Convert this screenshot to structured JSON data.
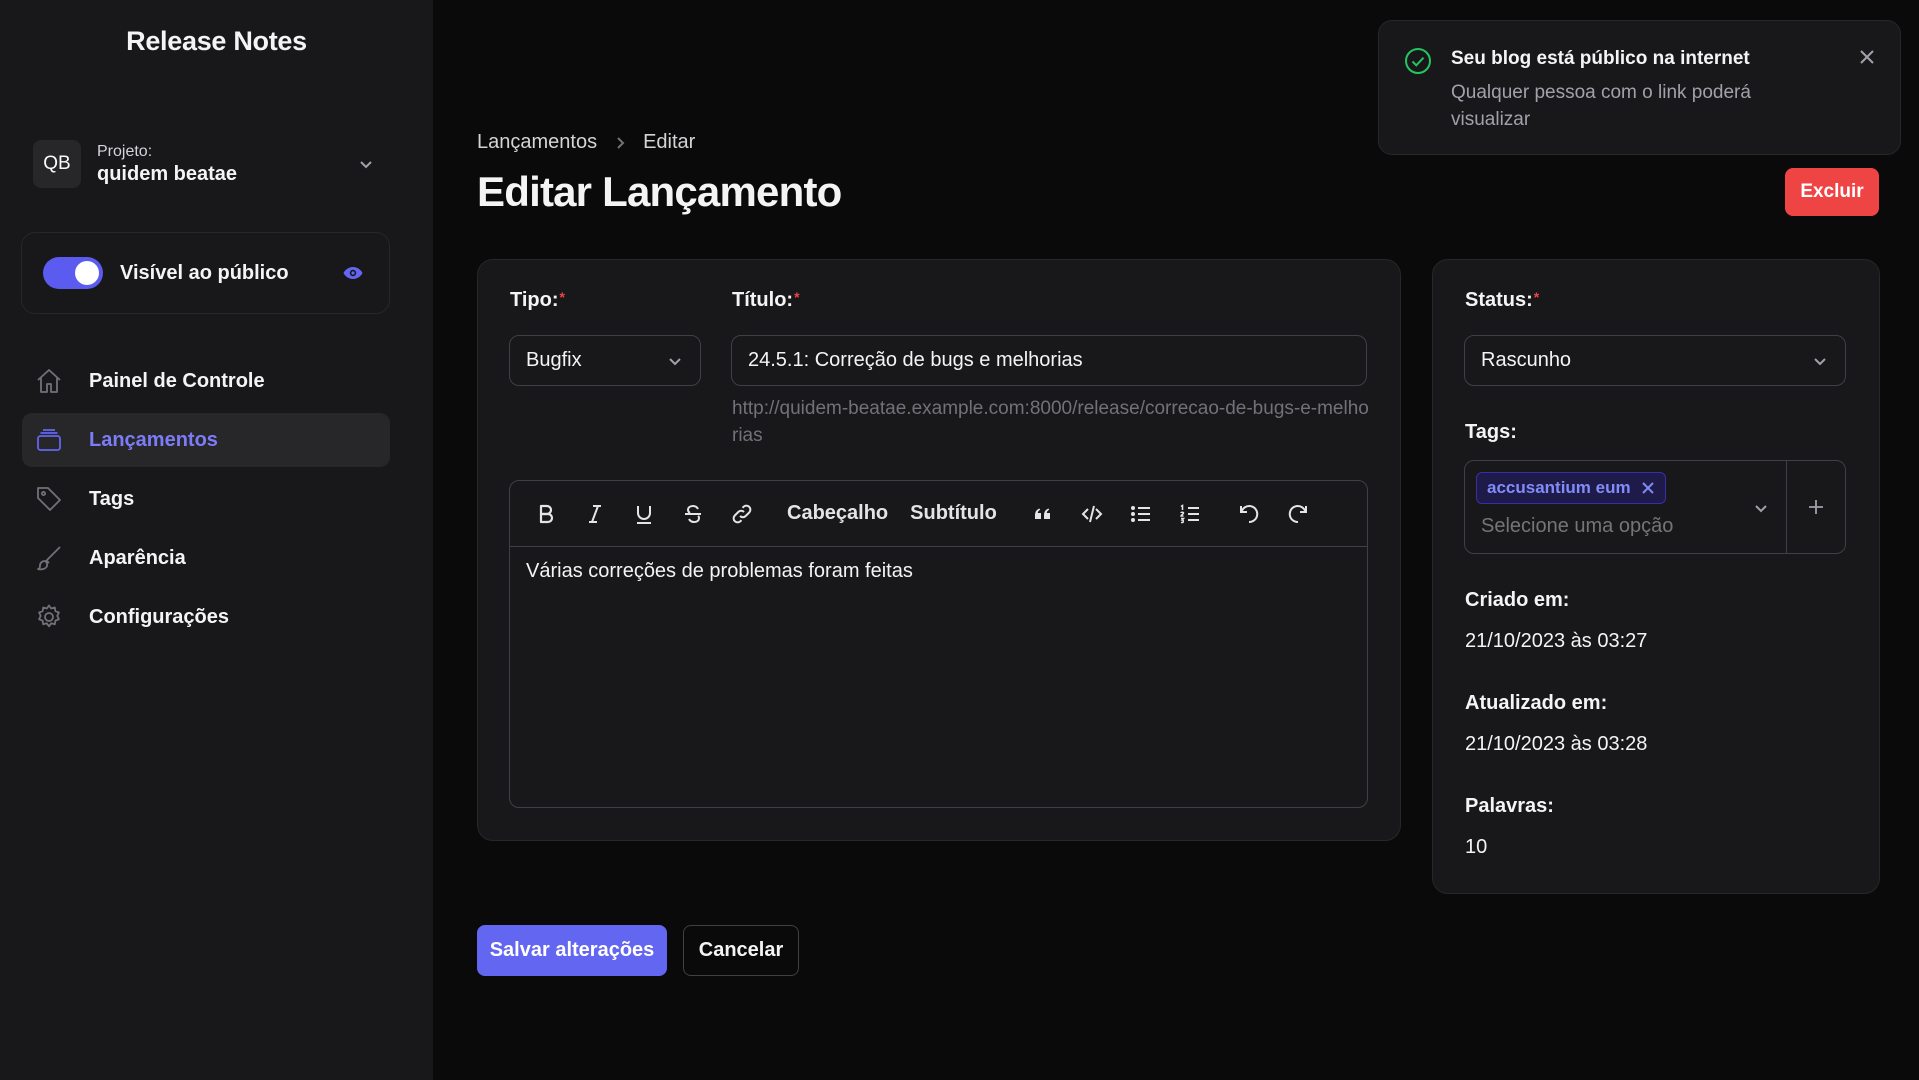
{
  "sidebar": {
    "app_title": "Release Notes",
    "project": {
      "avatar_initials": "QB",
      "label": "Projeto:",
      "name": "quidem beatae"
    },
    "visibility": {
      "label": "Visível ao público",
      "enabled": true
    },
    "nav": [
      {
        "label": "Painel de Controle",
        "icon": "home-icon",
        "active": false
      },
      {
        "label": "Lançamentos",
        "icon": "layers-icon",
        "active": true
      },
      {
        "label": "Tags",
        "icon": "tag-icon",
        "active": false
      },
      {
        "label": "Aparência",
        "icon": "brush-icon",
        "active": false
      },
      {
        "label": "Configurações",
        "icon": "gear-icon",
        "active": false
      }
    ]
  },
  "header": {
    "breadcrumb": [
      "Lançamentos",
      "Editar"
    ],
    "title": "Editar Lançamento",
    "delete_label": "Excluir"
  },
  "form": {
    "type": {
      "label": "Tipo:",
      "value": "Bugfix"
    },
    "title": {
      "label": "Título:",
      "value": "24.5.1: Correção de bugs e melhorias"
    },
    "slug_url": "http://quidem-beatae.example.com:8000/release/correcao-de-bugs-e-melhorias",
    "editor": {
      "heading_label": "Cabeçalho",
      "subtitle_label": "Subtítulo",
      "content": "Várias correções de problemas foram feitas"
    },
    "required_mark": "*"
  },
  "side": {
    "status": {
      "label": "Status:",
      "value": "Rascunho"
    },
    "tags": {
      "label": "Tags:",
      "selected": [
        "accusantium eum"
      ],
      "placeholder": "Selecione uma opção"
    },
    "created": {
      "label": "Criado em:",
      "value": "21/10/2023 às 03:27"
    },
    "updated": {
      "label": "Atualizado em:",
      "value": "21/10/2023 às 03:28"
    },
    "words": {
      "label": "Palavras:",
      "value": "10"
    }
  },
  "actions": {
    "save_label": "Salvar alterações",
    "cancel_label": "Cancelar"
  },
  "toast": {
    "title": "Seu blog está público na internet",
    "message": "Qualquer pessoa com o link poderá visualizar"
  },
  "colors": {
    "accent": "#6366f1",
    "danger": "#ef4444",
    "success": "#22c55e",
    "background": "#0a0a0a",
    "surface": "#18181b"
  }
}
